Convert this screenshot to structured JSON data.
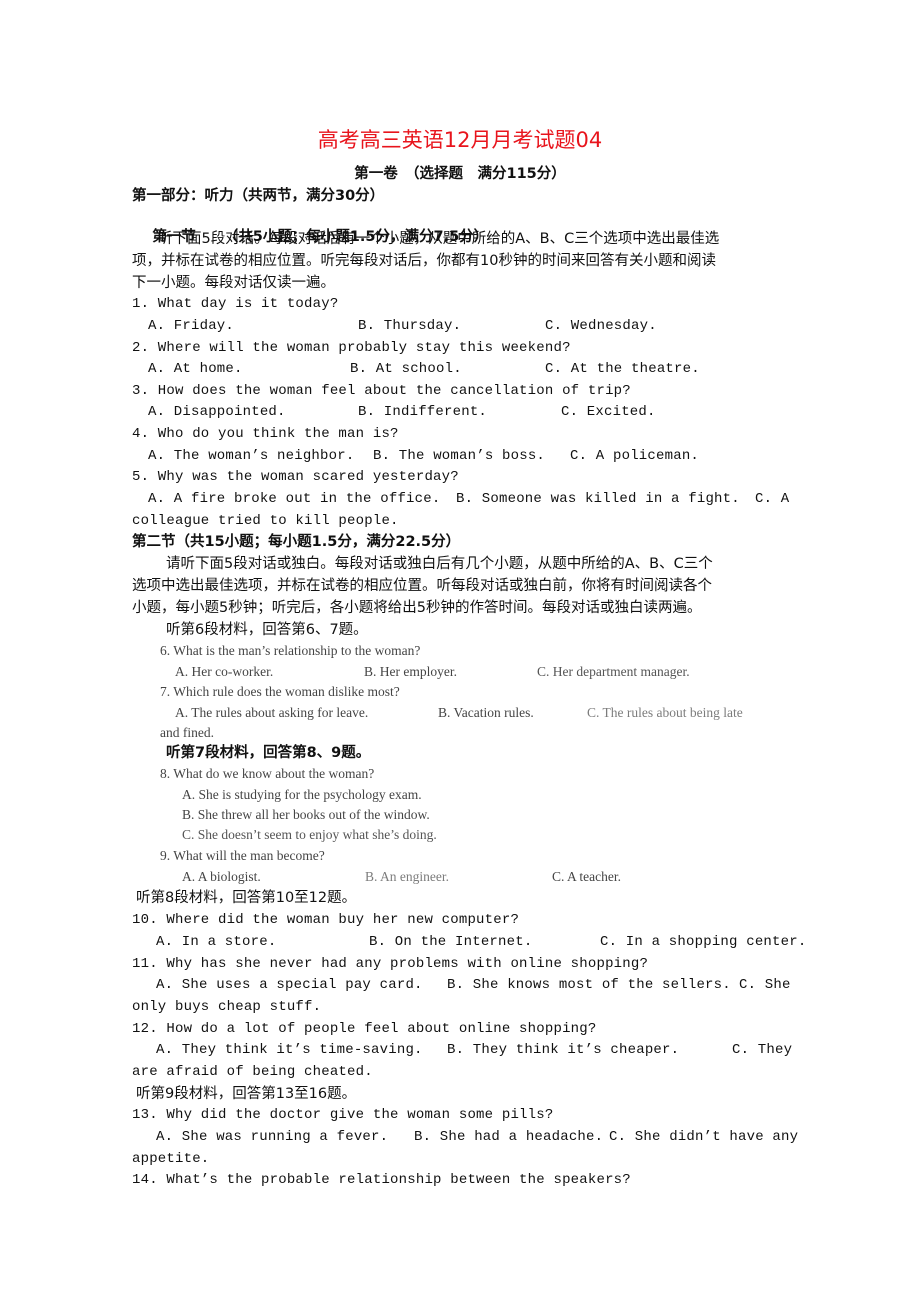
{
  "title": "高考高三英语12月月考试题04",
  "subtitle": "第一卷　（选择题　满分115分）",
  "part1": {
    "heading": "第一部分：听力（共两节，满分30分）",
    "section1": {
      "heading_label": "第一节",
      "heading_detail": "（共5小题；每小题1.5分，满分7.5分）",
      "instructions": [
        "听下面5段对话。每段对话后有一个小题，从题中所给的A、B、C三个选项中选出最佳选",
        "项，并标在试卷的相应位置。听完每段对话后，你都有10秒钟的时间来回答有关小题和阅读",
        "下一小题。每段对话仅读一遍。"
      ],
      "questions": [
        {
          "q": "1. What day is it today?",
          "a": "A. Friday.",
          "b": "B. Thursday.",
          "c": "C. Wednesday."
        },
        {
          "q": "2. Where will the woman probably stay this weekend?",
          "a": "A. At home.",
          "b": "B. At school.",
          "c": "C. At the theatre."
        },
        {
          "q": "3. How does the woman feel about the cancellation of trip?",
          "a": "A. Disappointed.",
          "b": "B. Indifferent.",
          "c": "C. Excited."
        },
        {
          "q": "4. Who do you think the man is?",
          "a": "A. The woman’s neighbor.",
          "b": "B. The woman’s boss.",
          "c": "C. A policeman."
        },
        {
          "q": "5. Why was the woman scared yesterday?",
          "a": "A. A fire broke out in the office.",
          "b": "B. Someone was killed in a fight.",
          "c": "C. A",
          "c_cont": "colleague tried to kill people."
        }
      ]
    },
    "section2": {
      "heading": "第二节（共15小题；每小题1.5分，满分22.5分）",
      "instructions": [
        "请听下面5段对话或独白。每段对话或独白后有几个小题，从题中所给的A、B、C三个",
        "选项中选出最佳选项，并标在试卷的相应位置。听每段对话或独白前，你将有时间阅读各个",
        "小题，每小题5秒钟；听完后，各小题将给出5秒钟的作答时间。每段对话或独白读两遍。"
      ],
      "groups": [
        {
          "label": "听第6段材料，回答第6、7题。",
          "questions": [
            {
              "q": "6. What is the man’s relationship to the woman?",
              "a": "A. Her co-worker.",
              "b": "B. Her employer.",
              "c": "C. Her department manager."
            },
            {
              "q": "7. Which rule does the woman dislike most?",
              "a": "A. The rules about asking for leave.",
              "b": "B. Vacation rules.",
              "c": "C. The rules about being late",
              "c_cont": "and fined."
            }
          ]
        },
        {
          "label": "听第7段材料，回答第8、9题。",
          "questions": [
            {
              "q": "8. What do we know about the woman?",
              "a": "A. She is studying for the psychology exam.",
              "b": "B. She threw all her books out of the window.",
              "c": "C. She doesn’t seem to enjoy what she’s doing."
            },
            {
              "q": "9. What will the man become?",
              "a": "A. A biologist.",
              "b": "B. An engineer.",
              "c": "C. A teacher."
            }
          ]
        },
        {
          "label": "听第8段材料，回答第10至12题。",
          "questions": [
            {
              "q": "10. Where did the woman buy her new computer?",
              "a": "A. In a store.",
              "b": "B. On the Internet.",
              "c": "C. In a shopping center."
            },
            {
              "q": "11. Why has she never had any problems with online shopping?",
              "a": "A. She uses a special pay card.",
              "b": "B. She knows most of the sellers.",
              "c": "C. She",
              "c_cont": "only buys cheap stuff."
            },
            {
              "q": "12. How do a lot of people feel about online shopping?",
              "a": "A. They think it’s time-saving.",
              "b": "B. They think it’s cheaper.",
              "c": "C. They",
              "c_cont": "are afraid of being cheated."
            }
          ]
        },
        {
          "label": "听第9段材料，回答第13至16题。",
          "questions": [
            {
              "q": "13. Why did the doctor give the woman some pills?",
              "a": "A. She was running a fever.",
              "b": "B. She had a headache.",
              "c": "C. She didn’t have any",
              "c_cont": "appetite."
            },
            {
              "q": "14. What’s the probable relationship between the speakers?"
            }
          ]
        }
      ]
    }
  },
  "colors": {
    "title": "#e8141c",
    "text": "#111111"
  }
}
